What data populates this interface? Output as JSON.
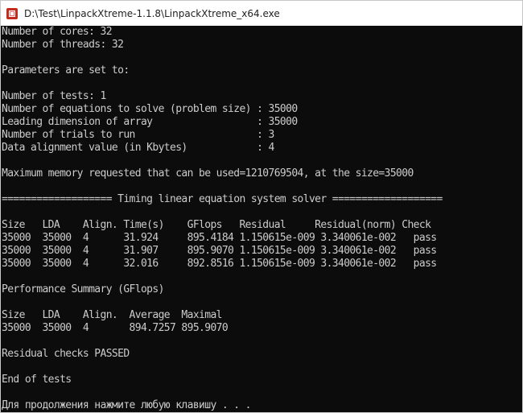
{
  "window": {
    "title": "D:\\Test\\LinpackXtreme-1.1.8\\LinpackXtreme_x64.exe",
    "icon": "app-icon"
  },
  "console": {
    "lines": [
      "Number of cores: 32",
      "Number of threads: 32",
      "",
      "Parameters are set to:",
      "",
      "Number of tests: 1",
      "Number of equations to solve (problem size) : 35000",
      "Leading dimension of array                  : 35000",
      "Number of trials to run                     : 3",
      "Data alignment value (in Kbytes)            : 4",
      "",
      "Maximum memory requested that can be used=1210769504, at the size=35000",
      "",
      "=================== Timing linear equation system solver ===================",
      "",
      "Size   LDA    Align. Time(s)    GFlops   Residual     Residual(norm) Check",
      "35000  35000  4      31.924     895.4184 1.150615e-009 3.340061e-002   pass",
      "35000  35000  4      31.907     895.9070 1.150615e-009 3.340061e-002   pass",
      "35000  35000  4      32.016     892.8516 1.150615e-009 3.340061e-002   pass",
      "",
      "Performance Summary (GFlops)",
      "",
      "Size   LDA    Align.  Average  Maximal",
      "35000  35000  4       894.7257 895.9070",
      "",
      "Residual checks PASSED",
      "",
      "End of tests",
      "",
      "Для продолжения нажмите любую клавишу . . ."
    ]
  },
  "colors": {
    "console_background": "#0c0c0c",
    "console_text": "#cccccc",
    "titlebar_background": "#ffffff"
  }
}
